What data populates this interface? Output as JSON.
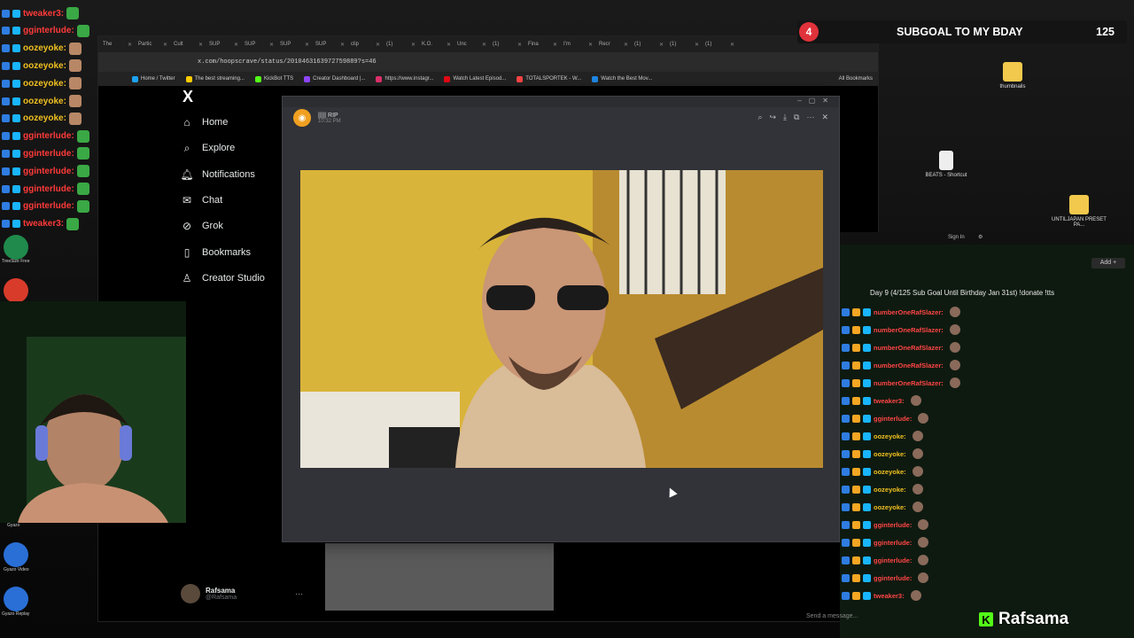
{
  "browser": {
    "tabs": [
      "The",
      "Partic",
      "Cult",
      "SUP",
      "SUP",
      "SUP",
      "SUP",
      "clip",
      "(1)",
      "K.O.",
      "Unc",
      "(1)",
      "Fina",
      "I'm",
      "Recr",
      "(1)",
      "(1)",
      "(1)"
    ],
    "url": "x.com/hoopscrave/status/2010463163972759889?s=46",
    "bookmarks": [
      "Home / Twitter",
      "The best streaming...",
      "KickBot TTS",
      "Creator Dashboard |...",
      "https://www.instagr...",
      "Watch Latest Episod...",
      "TOTALSPORTEK - W...",
      "Watch the Best Mov..."
    ],
    "all_bookmarks": "All Bookmarks"
  },
  "x_sidebar": {
    "logo": "X",
    "items": [
      {
        "label": "Home",
        "icon": "home-icon"
      },
      {
        "label": "Explore",
        "icon": "search-icon"
      },
      {
        "label": "Notifications",
        "icon": "bell-icon"
      },
      {
        "label": "Chat",
        "icon": "mail-icon"
      },
      {
        "label": "Grok",
        "icon": "grok-icon"
      },
      {
        "label": "Bookmarks",
        "icon": "bookmark-icon"
      },
      {
        "label": "Creator Studio",
        "icon": "creator-icon"
      }
    ],
    "profile": {
      "name": "Rafsama",
      "handle": "@Rafsama"
    }
  },
  "popup": {
    "username": "||||| RIP",
    "time": "10:32 PM"
  },
  "subgoal": {
    "count": "4",
    "title": "SUBGOAL TO MY BDAY",
    "target": "125"
  },
  "chat": {
    "signin": "Sign In",
    "add": "Add +",
    "header": "Day 9 (4/125 Sub Goal Until Birthday Jan 31st) !donate !tts",
    "messages": [
      {
        "user": "numberOneRafSlazer:",
        "color": "#ff4545"
      },
      {
        "user": "numberOneRafSlazer:",
        "color": "#ff4545"
      },
      {
        "user": "numberOneRafSlazer:",
        "color": "#ff4545"
      },
      {
        "user": "numberOneRafSlazer:",
        "color": "#ff4545"
      },
      {
        "user": "numberOneRafSlazer:",
        "color": "#ff4545"
      },
      {
        "user": "tweaker3:",
        "color": "#ff4545"
      },
      {
        "user": "gginterlude:",
        "color": "#ff4545"
      },
      {
        "user": "oozeyoke:",
        "color": "#f0c020"
      },
      {
        "user": "oozeyoke:",
        "color": "#f0c020"
      },
      {
        "user": "oozeyoke:",
        "color": "#f0c020"
      },
      {
        "user": "oozeyoke:",
        "color": "#f0c020"
      },
      {
        "user": "oozeyoke:",
        "color": "#f0c020"
      },
      {
        "user": "gginterlude:",
        "color": "#ff4545"
      },
      {
        "user": "gginterlude:",
        "color": "#ff4545"
      },
      {
        "user": "gginterlude:",
        "color": "#ff4545"
      },
      {
        "user": "gginterlude:",
        "color": "#ff4545"
      },
      {
        "user": "tweaker3:",
        "color": "#ff4545"
      }
    ],
    "input_placeholder": "Send a message...",
    "brand": "Rafsama"
  },
  "overlay_chat": [
    {
      "user": "tweaker3:",
      "color": "#ff3a3a"
    },
    {
      "user": "gginterlude:",
      "color": "#ff3a3a"
    },
    {
      "user": "oozeyoke:",
      "color": "#f0c020"
    },
    {
      "user": "oozeyoke:",
      "color": "#f0c020"
    },
    {
      "user": "oozeyoke:",
      "color": "#f0c020"
    },
    {
      "user": "oozeyoke:",
      "color": "#f0c020"
    },
    {
      "user": "oozeyoke:",
      "color": "#f0c020"
    },
    {
      "user": "gginterlude:",
      "color": "#ff3a3a"
    },
    {
      "user": "gginterlude:",
      "color": "#ff3a3a"
    },
    {
      "user": "gginterlude:",
      "color": "#ff3a3a"
    },
    {
      "user": "gginterlude:",
      "color": "#ff3a3a"
    },
    {
      "user": "gginterlude:",
      "color": "#ff3a3a"
    },
    {
      "user": "tweaker3:",
      "color": "#ff3a3a"
    }
  ],
  "desktop_icons": [
    {
      "label": "thumbnails"
    },
    {
      "label": "BEATS - Shortcut"
    },
    {
      "label": "UNTILJAPAN PRESET PA..."
    }
  ],
  "taskbar_labels": [
    "TreeSize Free",
    "Gyazo",
    "Gyazo Video",
    "Gyazo Replay"
  ]
}
